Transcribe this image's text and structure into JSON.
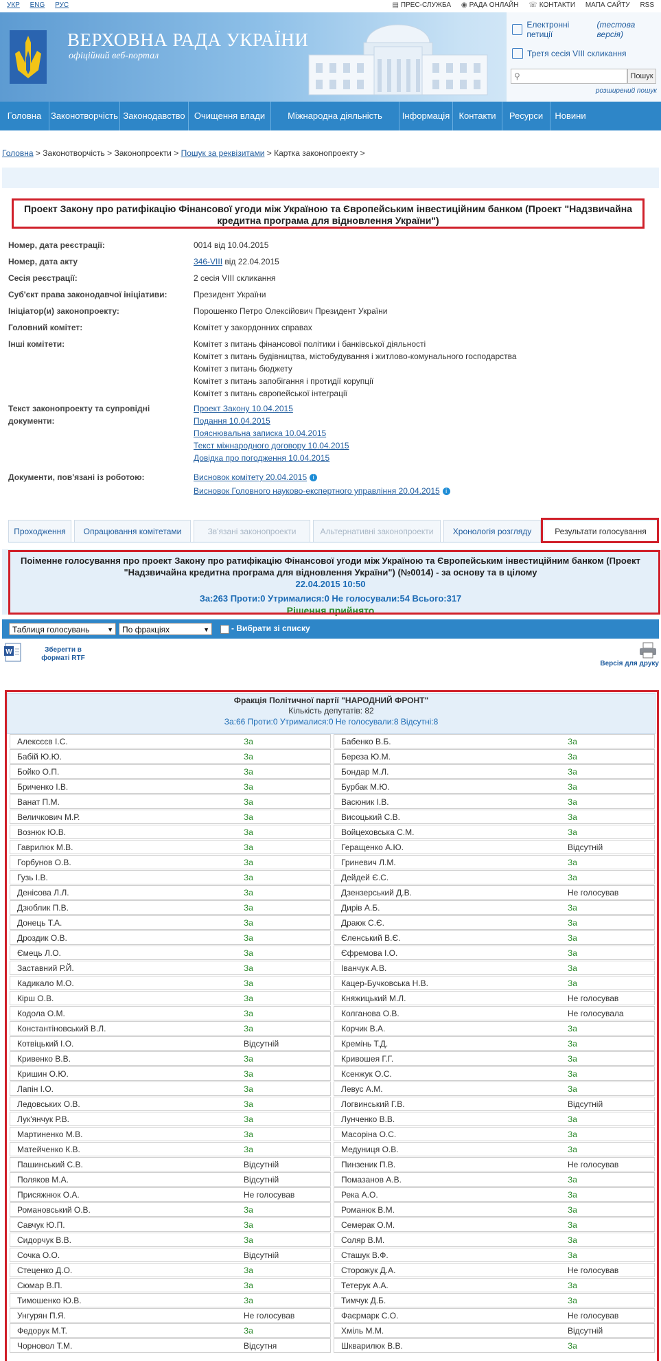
{
  "topbar": {
    "languages": [
      "УКР",
      "ENG",
      "РУС"
    ],
    "links": [
      "ПРЕС-СЛУЖБА",
      "РАДА ОНЛАЙН",
      "КОНТАКТИ",
      "МАПА САЙТУ",
      "RSS"
    ]
  },
  "header": {
    "title": "ВЕРХОВНА РАДА УКРАЇНИ",
    "subtitle": "офіційний веб-портал",
    "petitions_label": "Електронні петиції",
    "petitions_note": "(тестова версія)",
    "session_link": "Третя сесія VIII скликання",
    "search_placeholder": "",
    "search_button": "Пошук",
    "advanced_search": "розширений пошук"
  },
  "nav": [
    "Головна",
    "Законотворчість",
    "Законодавство",
    "Очищення влади",
    "Міжнародна діяльність",
    "Інформація",
    "Контакти",
    "Ресурси",
    "Новини"
  ],
  "breadcrumb": {
    "home": "Головна",
    "sep1": " > ",
    "law": "Законотворчість",
    "sep2": " > ",
    "bills": "Законопроекти",
    "sep3": " > ",
    "search": "Пошук за реквізитами",
    "sep4": " > ",
    "current": "Картка законопроекту",
    "sep5": " >"
  },
  "bill": {
    "title": "Проект Закону про ратифікацію Фінансової угоди між Україною та Європейським інвестиційним банком (Проект \"Надзвичайна кредитна програма для відновлення України\")",
    "fields": [
      {
        "label": "Номер, дата реєстрації:",
        "values": [
          "0014 від 10.04.2015"
        ]
      },
      {
        "label": "Номер, дата акту",
        "link": "346-VIII",
        "suffix": " від 22.04.2015"
      },
      {
        "label": "Сесія реєстрації:",
        "values": [
          "2 сесія VIII скликання"
        ]
      },
      {
        "label": "Суб'єкт права законодавчої ініціативи:",
        "values": [
          "Президент України"
        ]
      },
      {
        "label": "Ініціатор(и) законопроекту:",
        "values": [
          "Порошенко Петро Олексійович Президент України"
        ]
      },
      {
        "label": "Головний комітет:",
        "values": [
          "Комітет у закордонних справах"
        ]
      },
      {
        "label": "Інші комітети:",
        "values": [
          "Комітет з питань фінансової політики і банківської діяльності",
          "Комітет з питань будівництва, містобудування і житлово-комунального господарства",
          "Комітет з питань бюджету",
          "Комітет з питань запобігання і протидії корупції",
          "Комітет з питань європейської інтеграції"
        ]
      }
    ],
    "docs_label": "Текст законопроекту та супровідні документи:",
    "docs": [
      "Проект Закону 10.04.2015",
      "Подання 10.04.2015",
      "Пояснювальна записка 10.04.2015",
      "Текст міжнародного договору 10.04.2015",
      "Довідка про погодження 10.04.2015"
    ],
    "related_label": "Документи, пов'язані із роботою:",
    "related": [
      "Висновок комітету 20.04.2015",
      "Висновок Головного науково-експертного управління 20.04.2015"
    ]
  },
  "tabs": [
    "Проходження",
    "Опрацювання комітетами",
    "Зв'язані законопроекти",
    "Альтернативні законопроекти",
    "Хронологія розгляду",
    "Результати голосування"
  ],
  "vote": {
    "title": "Поіменне голосування про проект Закону про ратифікацію Фінансової угоди між Україною та Європейським інвестиційним банком (Проект \"Надзвичайна кредитна програма для відновлення України\") (№0014) - за основу та в цілому",
    "datetime": "22.04.2015 10:50",
    "counts": "За:263 Проти:0 Утрималися:0 Не голосували:54 Всього:317",
    "result": "Рішення прийнято"
  },
  "controls": {
    "table_select": "Таблиця голосувань",
    "group_select": "По фракціях",
    "choose_label": "- Вибрати зі списку",
    "rtf_label": "Зберегти в форматі RTF",
    "print_label": "Версія для друку"
  },
  "faction": {
    "name": "Фракція Політичної партії \"НАРОДНИЙ ФРОНТ\"",
    "count": "Кількість депутатів: 82",
    "summary": "За:66 Проти:0 Утрималися:0 Не голосували:8 Відсутні:8"
  },
  "deputies_left": [
    [
      "Алексєєв І.С.",
      "За"
    ],
    [
      "Бабій Ю.Ю.",
      "За"
    ],
    [
      "Бойко О.П.",
      "За"
    ],
    [
      "Бриченко І.В.",
      "За"
    ],
    [
      "Ванат П.М.",
      "За"
    ],
    [
      "Величкович М.Р.",
      "За"
    ],
    [
      "Вознюк Ю.В.",
      "За"
    ],
    [
      "Гаврилюк М.В.",
      "За"
    ],
    [
      "Горбунов О.В.",
      "За"
    ],
    [
      "Гузь І.В.",
      "За"
    ],
    [
      "Денісова Л.Л.",
      "За"
    ],
    [
      "Дзюблик П.В.",
      "За"
    ],
    [
      "Донець Т.А.",
      "За"
    ],
    [
      "Дроздик О.В.",
      "За"
    ],
    [
      "Ємець Л.О.",
      "За"
    ],
    [
      "Заставний Р.Й.",
      "За"
    ],
    [
      "Кадикало М.О.",
      "За"
    ],
    [
      "Кірш О.В.",
      "За"
    ],
    [
      "Кодола О.М.",
      "За"
    ],
    [
      "Константіновський В.Л.",
      "За"
    ],
    [
      "Котвіцький І.О.",
      "Відсутній"
    ],
    [
      "Кривенко В.В.",
      "За"
    ],
    [
      "Кришин О.Ю.",
      "За"
    ],
    [
      "Лапін І.О.",
      "За"
    ],
    [
      "Ледовських О.В.",
      "За"
    ],
    [
      "Лук'янчук Р.В.",
      "За"
    ],
    [
      "Мартиненко М.В.",
      "За"
    ],
    [
      "Матейченко К.В.",
      "За"
    ],
    [
      "Пашинський С.В.",
      "Відсутній"
    ],
    [
      "Поляков М.А.",
      "Відсутній"
    ],
    [
      "Присяжнюк О.А.",
      "Не голосував"
    ],
    [
      "Романовський О.В.",
      "За"
    ],
    [
      "Савчук Ю.П.",
      "За"
    ],
    [
      "Сидорчук В.В.",
      "За"
    ],
    [
      "Сочка О.О.",
      "Відсутній"
    ],
    [
      "Стеценко Д.О.",
      "За"
    ],
    [
      "Сюмар В.П.",
      "За"
    ],
    [
      "Тимошенко Ю.В.",
      "За"
    ],
    [
      "Унгурян П.Я.",
      "Не голосував"
    ],
    [
      "Федорук М.Т.",
      "За"
    ],
    [
      "Чорновол Т.М.",
      "Відсутня"
    ]
  ],
  "deputies_right": [
    [
      "Бабенко В.Б.",
      "За"
    ],
    [
      "Береза Ю.М.",
      "За"
    ],
    [
      "Бондар М.Л.",
      "За"
    ],
    [
      "Бурбак М.Ю.",
      "За"
    ],
    [
      "Васюник І.В.",
      "За"
    ],
    [
      "Висоцький С.В.",
      "За"
    ],
    [
      "Войцеховська С.М.",
      "За"
    ],
    [
      "Геращенко А.Ю.",
      "Відсутній"
    ],
    [
      "Гриневич Л.М.",
      "За"
    ],
    [
      "Дейдей Є.С.",
      "За"
    ],
    [
      "Дзензерський Д.В.",
      "Не голосував"
    ],
    [
      "Дирів А.Б.",
      "За"
    ],
    [
      "Драюк С.Є.",
      "За"
    ],
    [
      "Єленський В.Є.",
      "За"
    ],
    [
      "Єфремова І.О.",
      "За"
    ],
    [
      "Іванчук А.В.",
      "За"
    ],
    [
      "Кацер-Бучковська Н.В.",
      "За"
    ],
    [
      "Княжицький М.Л.",
      "Не голосував"
    ],
    [
      "Колганова О.В.",
      "Не голосувала"
    ],
    [
      "Корчик В.А.",
      "За"
    ],
    [
      "Кремінь Т.Д.",
      "За"
    ],
    [
      "Кривошея Г.Г.",
      "За"
    ],
    [
      "Ксенжук О.С.",
      "За"
    ],
    [
      "Левус А.М.",
      "За"
    ],
    [
      "Логвинський Г.В.",
      "Відсутній"
    ],
    [
      "Лунченко В.В.",
      "За"
    ],
    [
      "Масоріна О.С.",
      "За"
    ],
    [
      "Медуниця О.В.",
      "За"
    ],
    [
      "Пинзеник П.В.",
      "Не голосував"
    ],
    [
      "Помазанов А.В.",
      "За"
    ],
    [
      "Река А.О.",
      "За"
    ],
    [
      "Романюк В.М.",
      "За"
    ],
    [
      "Семерак О.М.",
      "За"
    ],
    [
      "Соляр В.М.",
      "За"
    ],
    [
      "Сташук В.Ф.",
      "За"
    ],
    [
      "Сторожук Д.А.",
      "Не голосував"
    ],
    [
      "Тетерук А.А.",
      "За"
    ],
    [
      "Тимчук Д.Б.",
      "За"
    ],
    [
      "Фаєрмарк С.О.",
      "Не голосував"
    ],
    [
      "Хміль М.М.",
      "Відсутній"
    ],
    [
      "Шкварилюк В.В.",
      "За"
    ]
  ],
  "colors": {
    "nav_blue": "#2e86c8",
    "highlight_red": "#d0202a",
    "vote_green": "#2c8a2c",
    "link_blue": "#1f5c9e"
  }
}
